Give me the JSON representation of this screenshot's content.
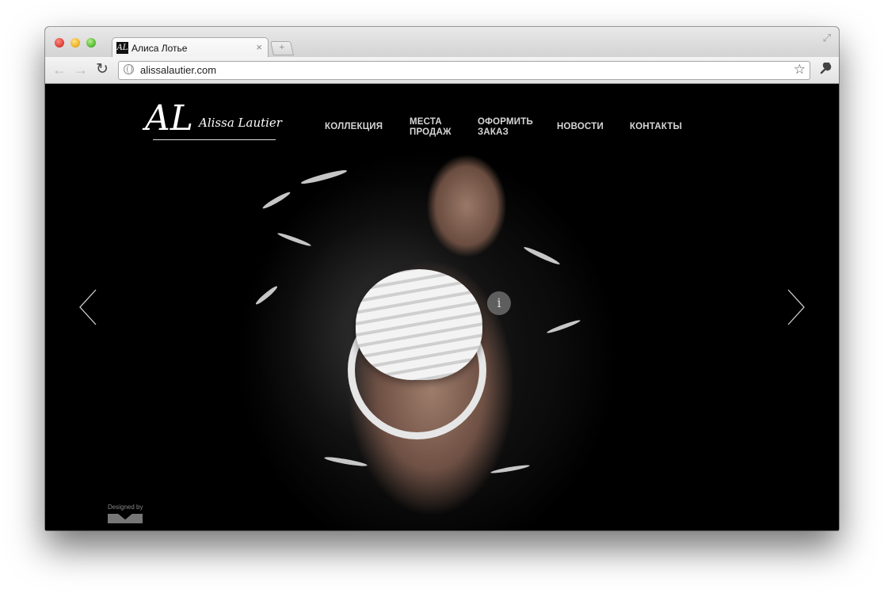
{
  "browser": {
    "tab_title": "Алиса Лотье",
    "tab_close_glyph": "×",
    "new_tab_glyph": "+",
    "url": "alissalautier.com",
    "back_glyph": "←",
    "forward_glyph": "→",
    "reload_glyph": "↻",
    "star_glyph": "☆",
    "wrench_glyph": "🔧",
    "fullscreen_glyph": "⤢",
    "favicon_text": "AL"
  },
  "site": {
    "logo": {
      "mark": "AL",
      "name": "Alissa Lautier"
    },
    "nav": [
      {
        "line1": "КОЛЛЕКЦИЯ",
        "line2": ""
      },
      {
        "line1": "МЕСТА",
        "line2": "ПРОДАЖ"
      },
      {
        "line1": "ОФОРМИТЬ",
        "line2": "ЗАКАЗ"
      },
      {
        "line1": "НОВОСТИ",
        "line2": ""
      },
      {
        "line1": "КОНТАКТЫ",
        "line2": ""
      }
    ],
    "info_glyph": "i",
    "designed_by": "Designed by",
    "arrows": {
      "prev": "prev-arrow-icon",
      "next": "next-arrow-icon"
    }
  }
}
